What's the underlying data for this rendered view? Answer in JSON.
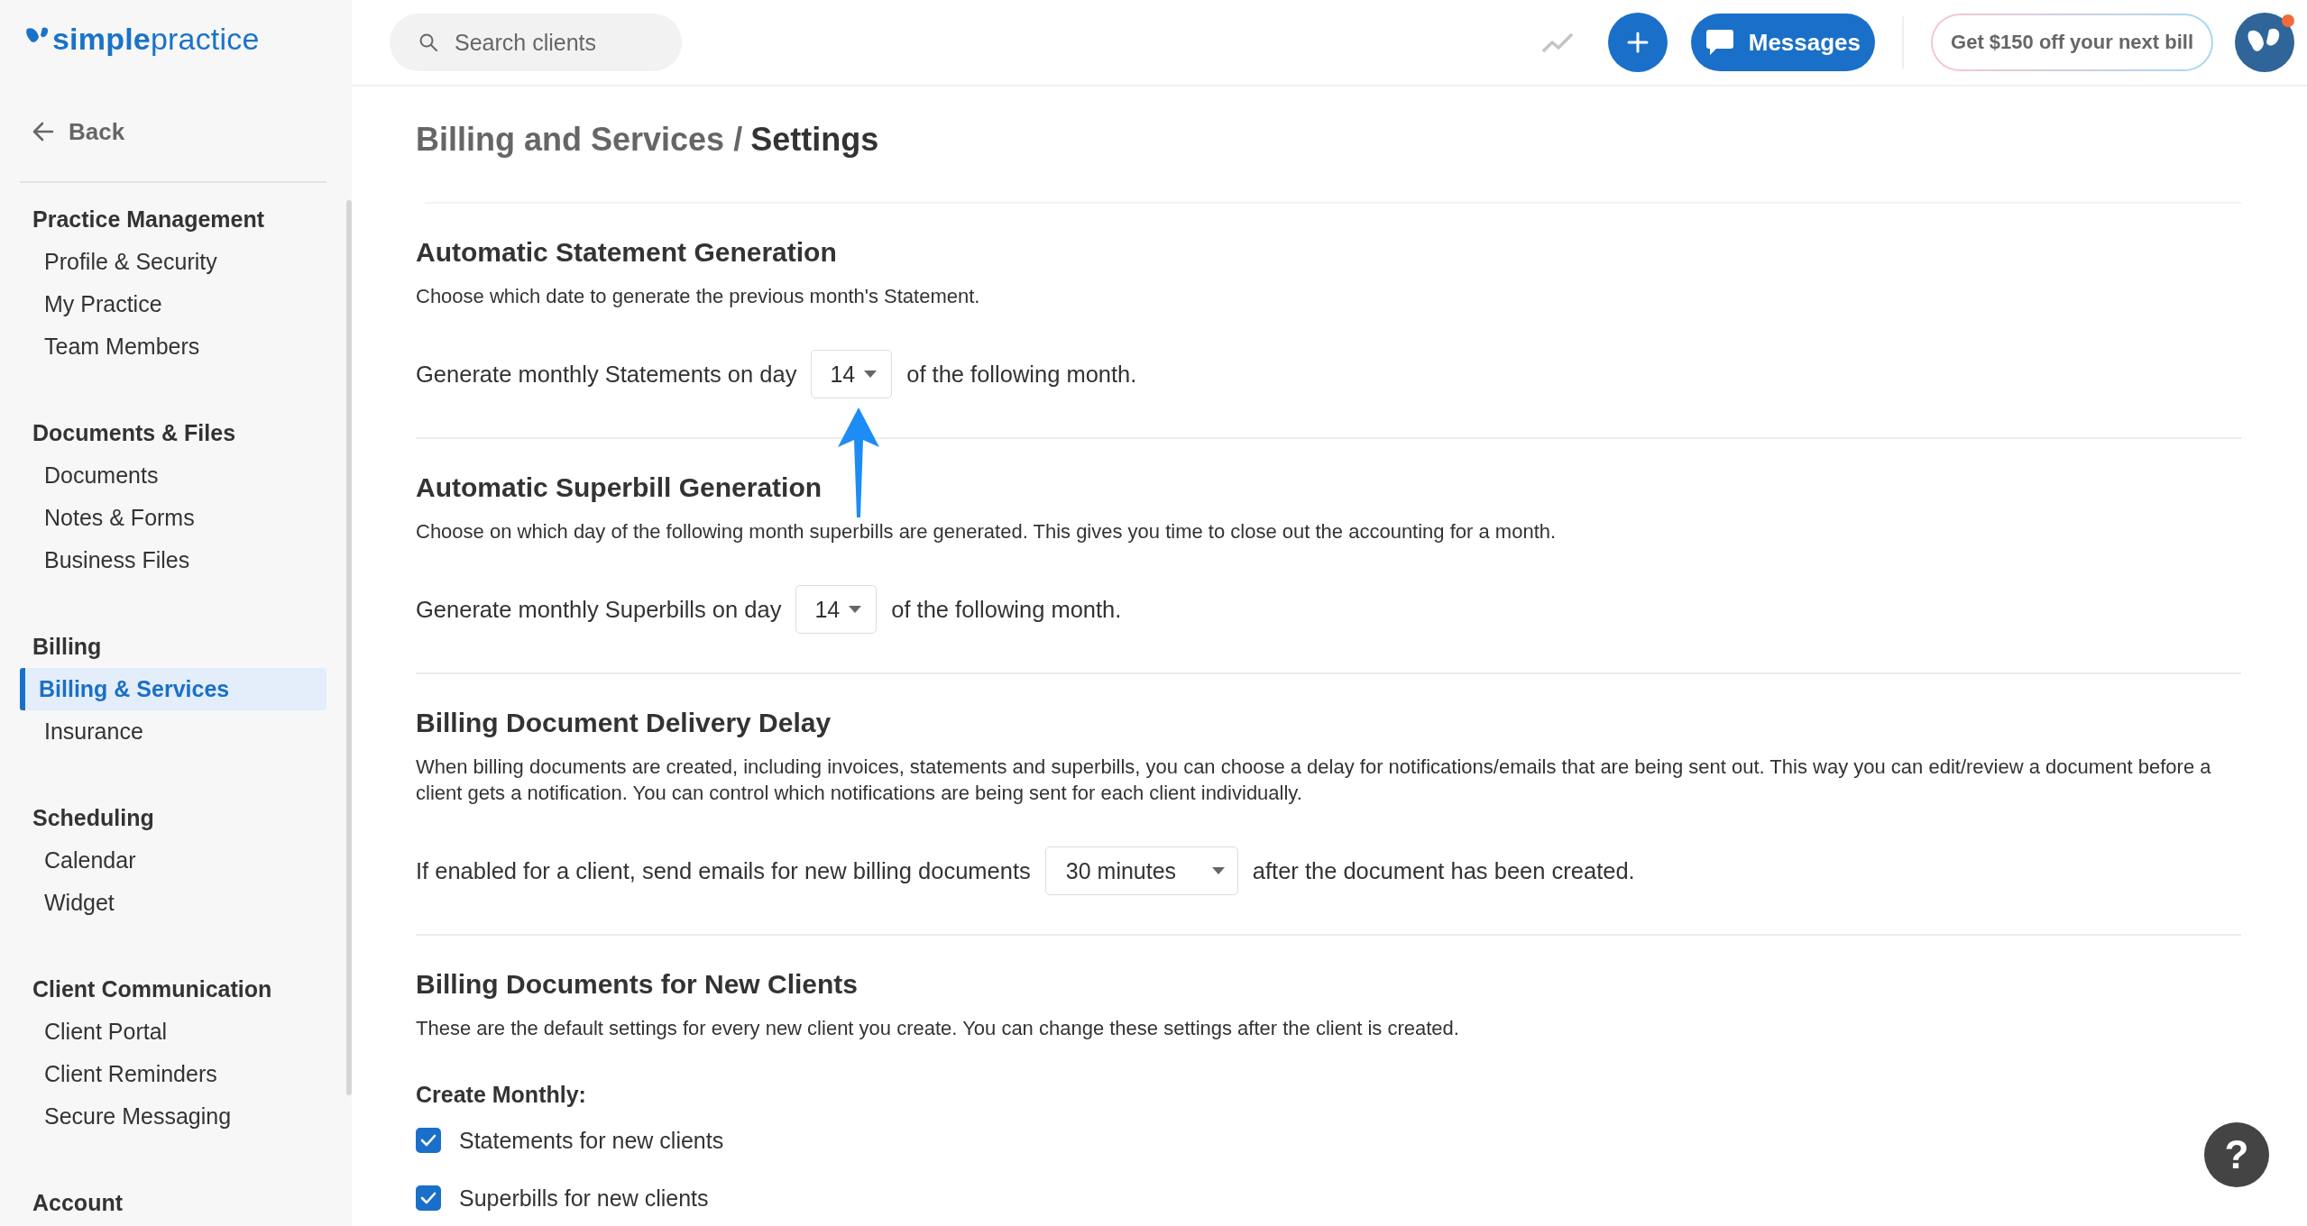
{
  "logo": {
    "text": "**simple**practice"
  },
  "search": {
    "placeholder": "Search clients"
  },
  "topbar": {
    "messages_button": "Messages",
    "promo_button": "Get $150 off your next bill",
    "avatar": {
      "notification": true
    }
  },
  "sidebar": {
    "back": "Back",
    "groups": [
      {
        "title": "Practice Management",
        "items": [
          {
            "label": "Profile & Security",
            "selected": false
          },
          {
            "label": "My Practice",
            "selected": false
          },
          {
            "label": "Team Members",
            "selected": false
          }
        ]
      },
      {
        "title": "Documents & Files",
        "items": [
          {
            "label": "Documents",
            "selected": false
          },
          {
            "label": "Notes & Forms",
            "selected": false
          },
          {
            "label": "Business Files",
            "selected": false
          }
        ]
      },
      {
        "title": "Billing",
        "items": [
          {
            "label": "Billing & Services",
            "selected": true
          },
          {
            "label": "Insurance",
            "selected": false
          }
        ]
      },
      {
        "title": "Scheduling",
        "items": [
          {
            "label": "Calendar",
            "selected": false
          },
          {
            "label": "Widget",
            "selected": false
          }
        ]
      },
      {
        "title": "Client Communication",
        "items": [
          {
            "label": "Client Portal",
            "selected": false
          },
          {
            "label": "Client Reminders",
            "selected": false
          },
          {
            "label": "Secure Messaging",
            "selected": false
          }
        ]
      },
      {
        "title": "Account"
      }
    ]
  },
  "page": {
    "breadcrumb": "Billing and Services /",
    "title": "Settings"
  },
  "sections": [
    {
      "kind": "select_row",
      "heading": "Automatic Statement Generation",
      "description": "Choose which date to generate the previous month's Statement.",
      "row": {
        "before": "Generate monthly Statements on day",
        "value": "14",
        "after": "of the following month."
      }
    },
    {
      "kind": "select_row",
      "heading": "Automatic Superbill Generation",
      "description": "Choose on which day of the following month superbills are generated. This gives you time to close out the accounting for a month.",
      "row": {
        "before": "Generate monthly Superbills on day",
        "value": "14",
        "after": "of the following month."
      }
    },
    {
      "kind": "select_row",
      "heading": "Billing Document Delivery Delay",
      "description": "When billing documents are created, including invoices, statements and superbills, you can choose a delay for notifications/emails that are being sent out. This way you can edit/review a document before a client gets a notification. You can control which notifications are being sent for each client individually.",
      "row": {
        "before": "If enabled for a client, send emails for new billing documents",
        "value": "30 minutes",
        "after": "after the document has been created."
      }
    },
    {
      "kind": "checkboxes",
      "heading": "Billing Documents for New Clients",
      "description": "These are the default settings for every new client you create. You can change these settings after the client is created.",
      "subheading": "Create Monthly:",
      "options": [
        {
          "label": "Statements for new clients",
          "checked": true
        },
        {
          "label": "Superbills for new clients",
          "checked": true
        }
      ]
    }
  ],
  "help_button": "?"
}
